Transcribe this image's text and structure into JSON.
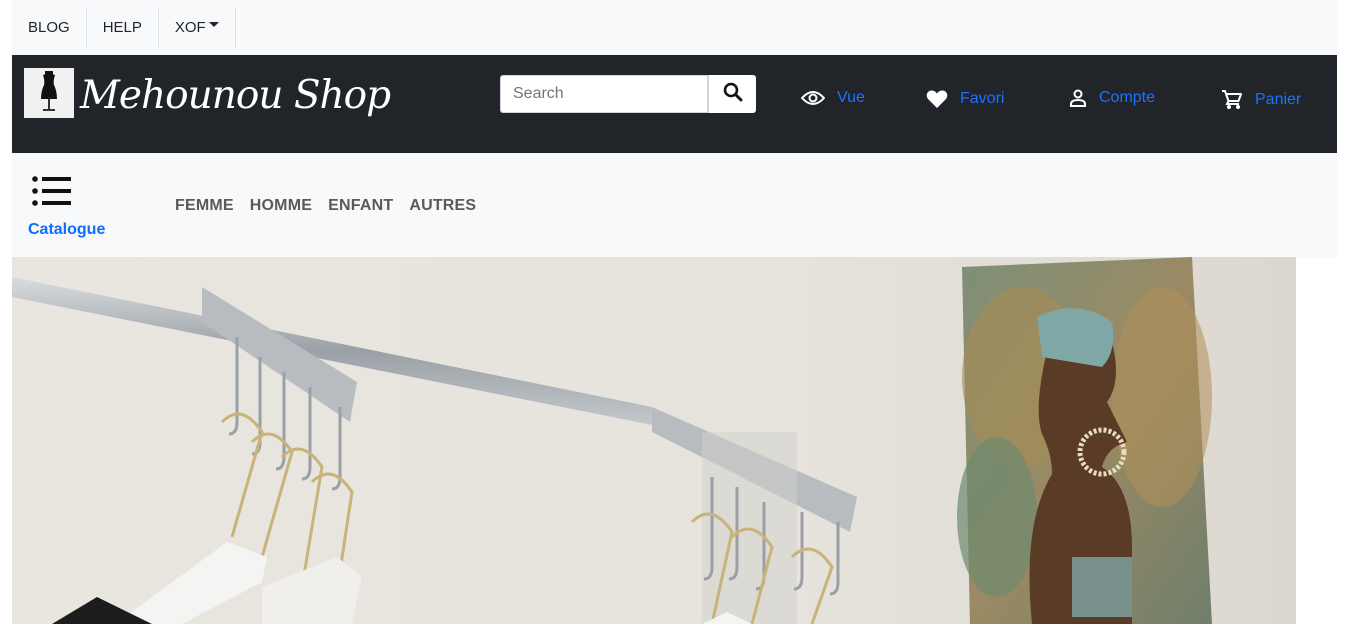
{
  "topbar": {
    "items": [
      {
        "label": "BLOG"
      },
      {
        "label": "HELP"
      },
      {
        "label": "XOF"
      }
    ]
  },
  "header": {
    "brand": "Mehounou Shop",
    "logo_icon": "dress-form-icon",
    "search": {
      "placeholder": "Search",
      "value": ""
    },
    "nav": [
      {
        "label": "Vue",
        "icon": "eye-icon"
      },
      {
        "label": "Favori",
        "icon": "heart-icon"
      },
      {
        "label": "Compte",
        "icon": "user-icon"
      },
      {
        "label": "Panier",
        "icon": "cart-icon"
      }
    ]
  },
  "catbar": {
    "catalogue_label": "Catalogue",
    "categories": [
      {
        "label": "FEMME"
      },
      {
        "label": "HOMME"
      },
      {
        "label": "ENFANT"
      },
      {
        "label": "AUTRES"
      }
    ]
  },
  "colors": {
    "header_bg": "#212529",
    "link_blue": "#0d6efd",
    "light_bg": "#f8f9fa"
  }
}
